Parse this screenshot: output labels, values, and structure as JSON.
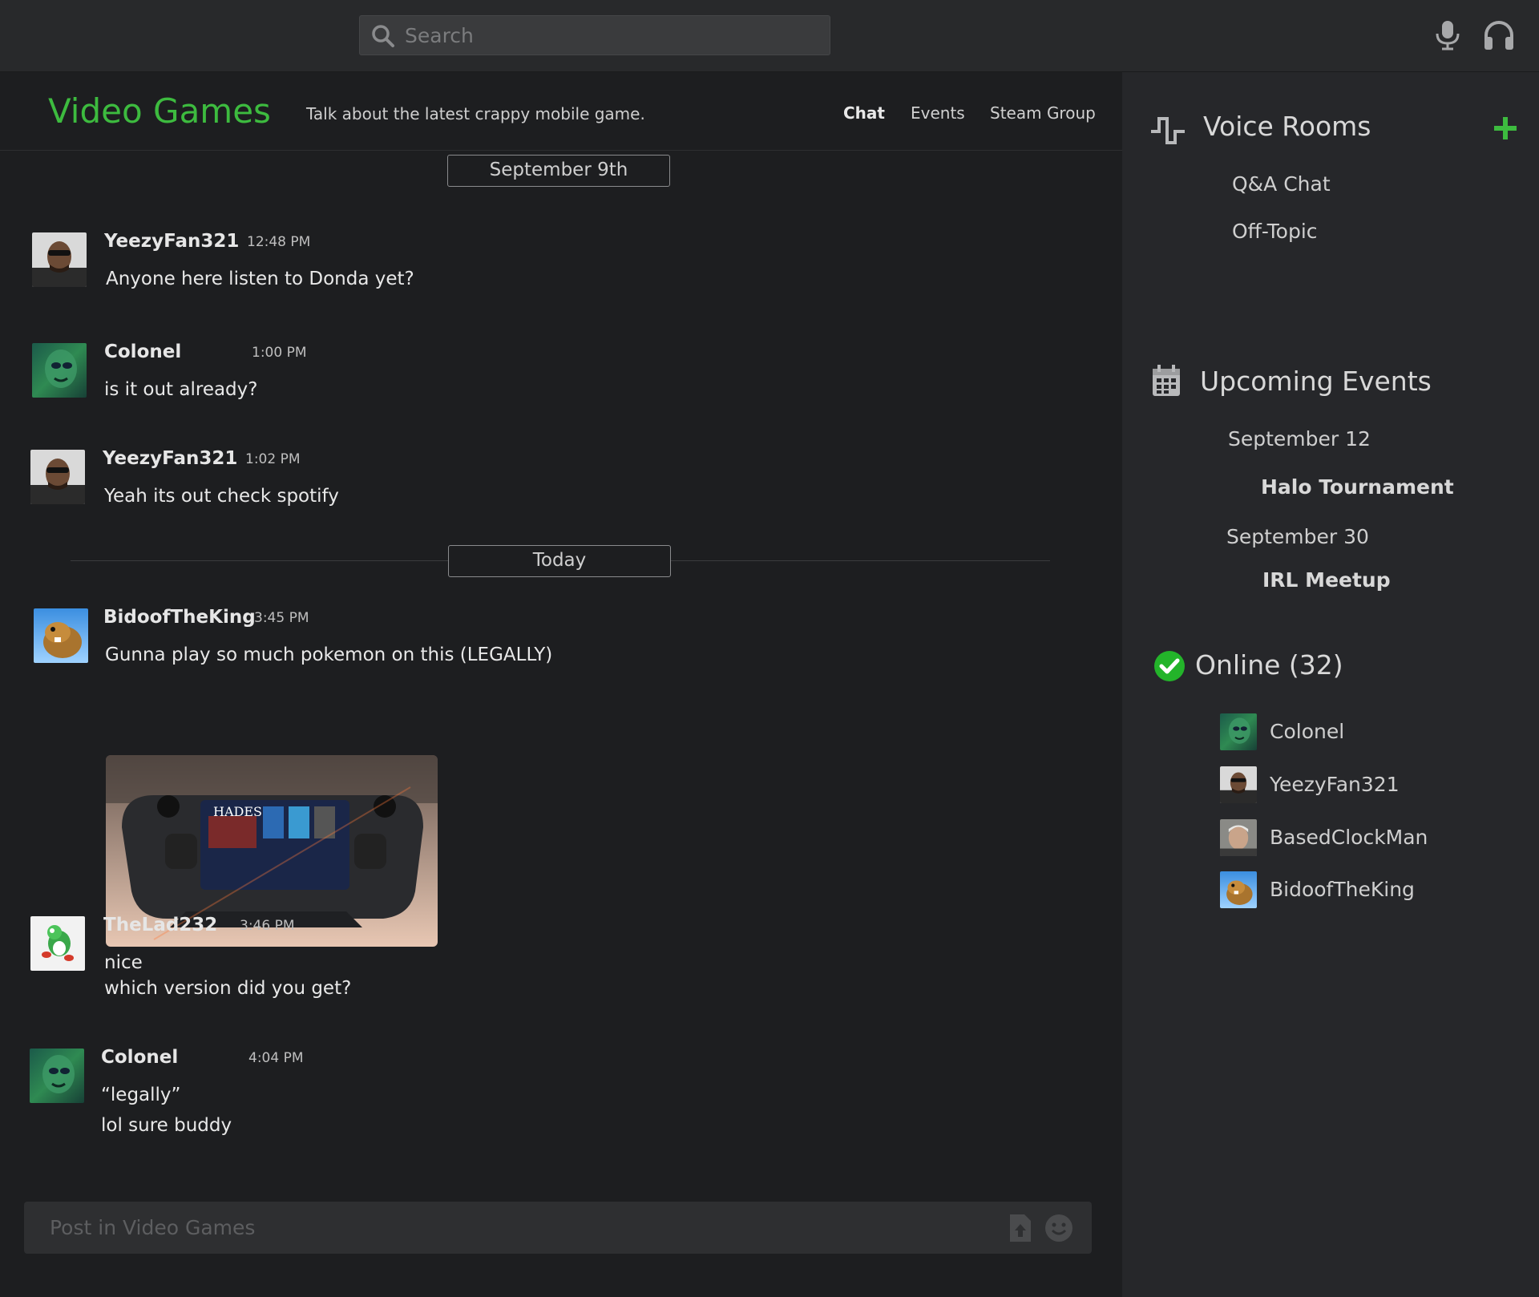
{
  "search": {
    "placeholder": "Search"
  },
  "channel": {
    "title": "Video Games",
    "description": "Talk about the latest crappy mobile game.",
    "tabs": [
      "Chat",
      "Events",
      "Steam Group"
    ]
  },
  "dates": {
    "first": "September 9th",
    "second": "Today"
  },
  "messages": [
    {
      "author": "YeezyFan321",
      "time": "12:48 PM",
      "lines": [
        "Anyone here listen to Donda yet?"
      ]
    },
    {
      "author": "Colonel",
      "time": "1:00 PM",
      "lines": [
        "is it out already?"
      ]
    },
    {
      "author": "YeezyFan321",
      "time": "1:02 PM",
      "lines": [
        "Yeah its out check spotify"
      ]
    },
    {
      "author": "BidoofTheKing",
      "time": "3:45 PM",
      "lines": [
        "Gunna play so much pokemon on this (LEGALLY)"
      ]
    },
    {
      "author": "TheLad232",
      "time": "3:46 PM",
      "lines": [
        "nice",
        "which version did you get?"
      ]
    },
    {
      "author": "Colonel",
      "time": "4:04 PM",
      "lines": [
        "“legally”",
        "lol sure buddy"
      ]
    }
  ],
  "attachment": {
    "screen_text": "HADES"
  },
  "composer": {
    "placeholder": "Post in Video Games"
  },
  "sidebar": {
    "voice_title": "Voice Rooms",
    "voice_rooms": [
      "Q&A Chat",
      "Off-Topic"
    ],
    "events_title": "Upcoming Events",
    "events": [
      {
        "date": "September 12",
        "name": "Halo Tournament"
      },
      {
        "date": "September 30",
        "name": "IRL Meetup"
      }
    ],
    "online_title": "Online (32)",
    "online_users": [
      "Colonel",
      "YeezyFan321",
      "BasedClockMan",
      "BidoofTheKing"
    ]
  },
  "colors": {
    "accent": "#3dbb3f",
    "background": "#1d1e20",
    "sidebar": "#26272a",
    "topbar": "#28292b"
  },
  "icons": [
    "search-icon",
    "microphone-icon",
    "headphones-icon",
    "file-upload-icon",
    "emoji-icon",
    "waveform-icon",
    "calendar-icon",
    "check-circle-icon",
    "plus-icon"
  ]
}
